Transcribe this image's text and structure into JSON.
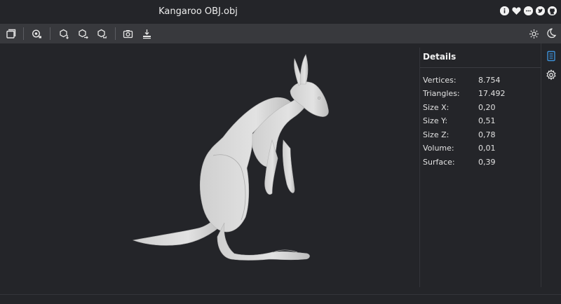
{
  "window": {
    "title": "Kangaroo OBJ.obj",
    "header_icons": [
      "info-icon",
      "heart-icon",
      "feedback-icon",
      "twitter-icon",
      "github-icon"
    ]
  },
  "toolbar": {
    "buttons": [
      "open-file-icon",
      "fit-view-icon",
      "fix-up-y-icon",
      "fix-up-z-icon",
      "flip-up-icon",
      "snapshot-icon",
      "export-icon"
    ],
    "right_buttons": [
      "light-mode-icon",
      "dark-mode-icon"
    ]
  },
  "details": {
    "title": "Details",
    "rows": [
      {
        "label": "Vertices:",
        "value": "8.754"
      },
      {
        "label": "Triangles:",
        "value": "17.492"
      },
      {
        "label": "Size X:",
        "value": "0,20"
      },
      {
        "label": "Size Y:",
        "value": "0,51"
      },
      {
        "label": "Size Z:",
        "value": "0,78"
      },
      {
        "label": "Volume:",
        "value": "0,01"
      },
      {
        "label": "Surface:",
        "value": "0,39"
      }
    ]
  },
  "sidebar": {
    "icons": [
      "details-icon",
      "settings-icon"
    ],
    "accent": "#3d8fd6"
  },
  "model": {
    "color": "#d9d9d9",
    "background": "#242529"
  }
}
